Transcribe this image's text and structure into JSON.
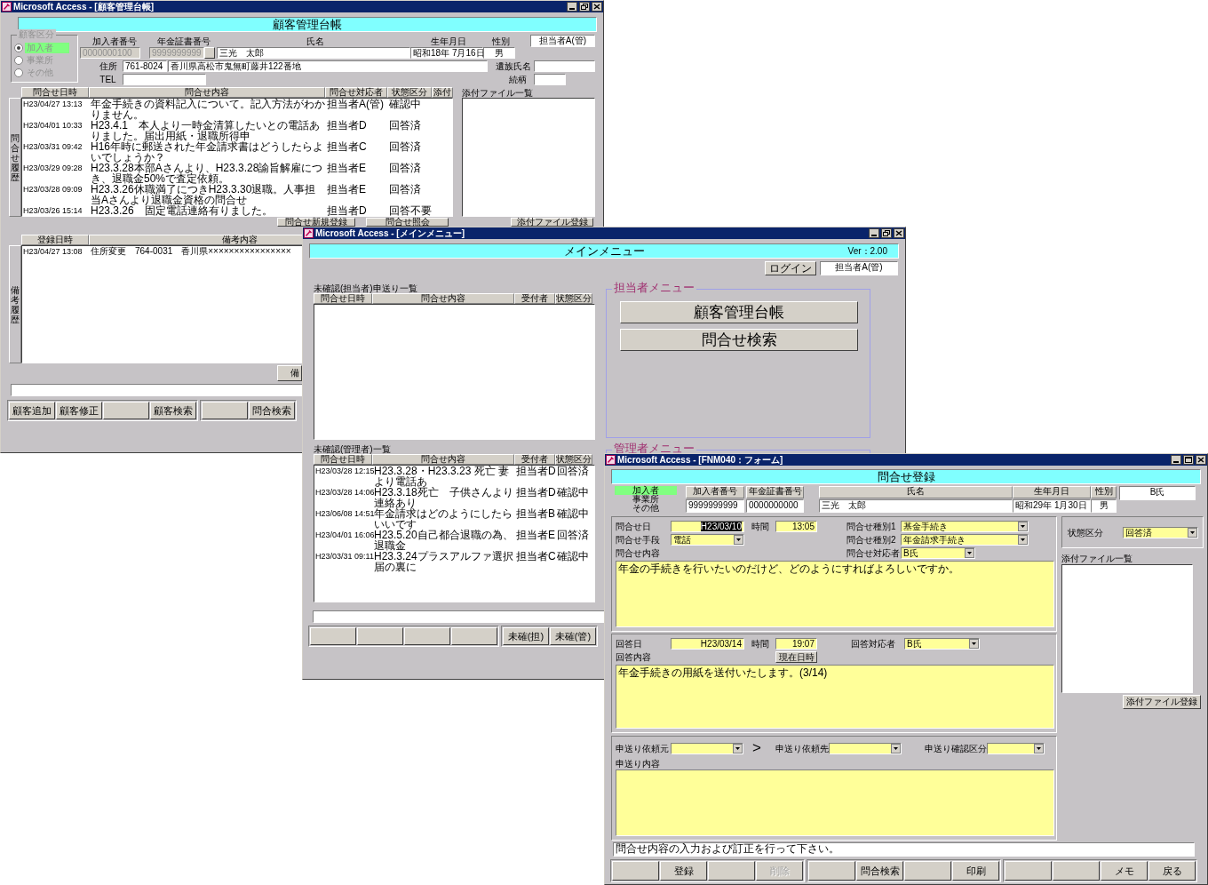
{
  "customer_ledger": {
    "title": "Microsoft Access - [顧客管理台帳]",
    "heading": "顧客管理台帳",
    "customer_type": {
      "legend": "顧客区分",
      "options": [
        {
          "label": "加入者",
          "selected": true
        },
        {
          "label": "事業所",
          "selected": false
        },
        {
          "label": "その他",
          "selected": false
        }
      ]
    },
    "member_no": {
      "label": "加入者番号",
      "value": "0000000100",
      "disabled": true
    },
    "pension_no": {
      "label": "年金証書番号",
      "value": "9999999999",
      "disabled": true
    },
    "name": {
      "label": "氏名",
      "value": "三光　太郎"
    },
    "birth_date": {
      "label": "生年月日",
      "value": "昭和18年 7月16日"
    },
    "gender": {
      "label": "性別",
      "value": "男"
    },
    "staff": "担当者A(管)",
    "address": {
      "label": "住所",
      "postal_code": "761-8024",
      "value": "香川県高松市鬼無町藤井122番地"
    },
    "tel": {
      "label": "TEL"
    },
    "bereaved_name": {
      "label": "遺族氏名"
    },
    "relationship": {
      "label": "続柄"
    },
    "inquiry_history": {
      "side_label": "問合せ履歴",
      "columns": [
        "問合せ日時",
        "問合せ内容",
        "問合せ対応者",
        "状態区分",
        "添付"
      ],
      "rows": [
        {
          "datetime": "H23/04/27 13:13",
          "content": "年金手続きの資料記入について。記入方法がわかりません。",
          "handler": "担当者A(管)",
          "status": "確認中"
        },
        {
          "datetime": "H23/04/01 10:33",
          "content": "H23.4.1　本人より一時金清算したいとの電話ありました。届出用紙・退職所得申",
          "handler": "担当者D",
          "status": "回答済"
        },
        {
          "datetime": "H23/03/31 09:42",
          "content": "H16年時に郵送された年金請求書はどうしたらよいでしょうか？",
          "handler": "担当者C",
          "status": "回答済"
        },
        {
          "datetime": "H23/03/29 09:28",
          "content": "H23.3.28本部Aさんより、H23.3.28諭旨解雇につき、退職金50%で査定依頼。",
          "handler": "担当者E",
          "status": "回答済"
        },
        {
          "datetime": "H23/03/28 09:09",
          "content": "H23.3.26休職満了につきH23.3.30退職。人事担当Aさんより退職金資格の問合せ",
          "handler": "担当者E",
          "status": "回答済"
        },
        {
          "datetime": "H23/03/26 15:14",
          "content": "H23.3.26　固定電話連絡有りました。",
          "handler": "担当者D",
          "status": "回答不要"
        }
      ]
    },
    "attachments_label": "添付ファイル一覧",
    "inquiry_buttons": [
      "問合せ新規登録",
      "問合せ照会",
      "添付ファイル登録"
    ],
    "notes_history": {
      "side_label": "備考履歴",
      "columns": [
        "登録日時",
        "備考内容"
      ],
      "rows": [
        {
          "datetime": "H23/04/27 13:08",
          "content": "住所変更　764-0031　香川県××××××××××××××××"
        }
      ]
    },
    "notes_button": "備",
    "footer": [
      [
        {
          "kind": "button",
          "label": "顧客追加"
        },
        {
          "kind": "button",
          "label": "顧客修正"
        },
        {
          "kind": "blank"
        },
        {
          "kind": "button",
          "label": "顧客検索"
        }
      ],
      [
        {
          "kind": "blank"
        },
        {
          "kind": "button",
          "label": "問合検索"
        }
      ]
    ]
  },
  "main_menu": {
    "title": "Microsoft Access - [メインメニュー]",
    "heading": "メインメニュー",
    "version": "Ver：2.00",
    "login_button": "ログイン",
    "user": "担当者A(管)",
    "staff_pending": {
      "label": "未確認(担当者)申送り一覧",
      "columns": [
        "問合せ日時",
        "問合せ内容",
        "受付者",
        "状態区分"
      ]
    },
    "admin_pending": {
      "label": "未確認(管理者)一覧",
      "columns": [
        "問合せ日時",
        "問合せ内容",
        "受付者",
        "状態区分"
      ],
      "rows": [
        {
          "datetime": "H23/03/28 12:15",
          "content": "H23.3.28・H23.3.23 死亡 妻より電話あ",
          "receiver": "担当者D",
          "status": "回答済"
        },
        {
          "datetime": "H23/03/28 14:06",
          "content": "H23.3.18死亡　子供さんより連絡あり",
          "receiver": "担当者D",
          "status": "確認中"
        },
        {
          "datetime": "H23/06/08 14:51",
          "content": "年金請求はどのようにしたらいいです",
          "receiver": "担当者B",
          "status": "確認中"
        },
        {
          "datetime": "H23/04/01 16:06",
          "content": "H23.5.20自己都合退職の為、退職金",
          "receiver": "担当者E",
          "status": "回答済"
        },
        {
          "datetime": "H23/03/31 09:11",
          "content": "H23.3.24プラスアルファ選択届の裏に",
          "receiver": "担当者C",
          "status": "確認中"
        }
      ]
    },
    "staff_menu": {
      "legend": "担当者メニュー",
      "buttons": [
        "顧客管理台帳",
        "問合せ検索"
      ]
    },
    "admin_menu": {
      "legend": "管理者メニュー"
    },
    "footer": [
      [
        {
          "kind": "blank"
        },
        {
          "kind": "blank"
        },
        {
          "kind": "blank"
        },
        {
          "kind": "blank"
        }
      ],
      [
        {
          "kind": "button",
          "label": "未確(担)"
        },
        {
          "kind": "button",
          "label": "未確(管)"
        }
      ]
    ]
  },
  "inquiry_form": {
    "title": "Microsoft Access - [FNM040：フォーム]",
    "heading": "問合せ登録",
    "member_types": [
      {
        "label": "加入者",
        "selected": true
      },
      {
        "label": "事業所",
        "selected": false
      },
      {
        "label": "その他",
        "selected": false
      }
    ],
    "member_no": {
      "label": "加入者番号",
      "value": "9999999999"
    },
    "pension_no": {
      "label": "年金証書番号",
      "value": "0000000000"
    },
    "name": {
      "label": "氏名",
      "value": "三光　太郎"
    },
    "birth_date": {
      "label": "生年月日",
      "value": "昭和29年 1月30日"
    },
    "gender": {
      "label": "性別",
      "value": "男"
    },
    "staff": "B氏",
    "inquiry_date": {
      "label": "問合せ日",
      "value": "H23/03/10",
      "highlighted": true
    },
    "inquiry_time": {
      "label": "時間",
      "value": "13:05"
    },
    "inquiry_method": {
      "label": "問合せ手段",
      "value": "電話"
    },
    "inquiry_type_1": {
      "label": "問合せ種別1",
      "value": "基金手続き"
    },
    "inquiry_type_2": {
      "label": "問合せ種別2",
      "value": "年金請求手続き"
    },
    "inquiry_handler": {
      "label": "問合せ対応者",
      "value": "B氏"
    },
    "inquiry_content": {
      "label": "問合せ内容",
      "value": "年金の手続きを行いたいのだけど、どのようにすればよろしいですか。"
    },
    "answer_date": {
      "label": "回答日",
      "value": "H23/03/14",
      "highlighted": false
    },
    "answer_time": {
      "label": "時間",
      "value": "19:07"
    },
    "now_button": "現在日時",
    "answer_handler": {
      "label": "回答対応者",
      "value": "B氏"
    },
    "answer_content": {
      "label": "回答内容",
      "value": "年金手続きの用紙を送付いたします。(3/14)"
    },
    "handover_from": {
      "label": "申送り依頼元"
    },
    "handover_arrow": ">",
    "handover_to": {
      "label": "申送り依頼先"
    },
    "handover_check": {
      "label": "申送り確認区分"
    },
    "handover_content": {
      "label": "申送り内容"
    },
    "status": {
      "label": "状態区分",
      "value": "回答済"
    },
    "attachments": {
      "label": "添付ファイル一覧",
      "button": "添付ファイル登録"
    },
    "message": "問合せ内容の入力および訂正を行って下さい。",
    "footer": [
      [
        {
          "kind": "blank"
        },
        {
          "kind": "button",
          "label": "登録",
          "disabled": false
        },
        {
          "kind": "blank"
        },
        {
          "kind": "button",
          "label": "削除",
          "disabled": true
        }
      ],
      [
        {
          "kind": "blank"
        },
        {
          "kind": "button",
          "label": "問合検索",
          "disabled": false
        },
        {
          "kind": "blank"
        },
        {
          "kind": "button",
          "label": "印刷",
          "disabled": false
        }
      ],
      [
        {
          "kind": "blank"
        },
        {
          "kind": "blank"
        },
        {
          "kind": "button",
          "label": "メモ",
          "disabled": false
        },
        {
          "kind": "button",
          "label": "戻る",
          "disabled": false
        }
      ]
    ]
  }
}
